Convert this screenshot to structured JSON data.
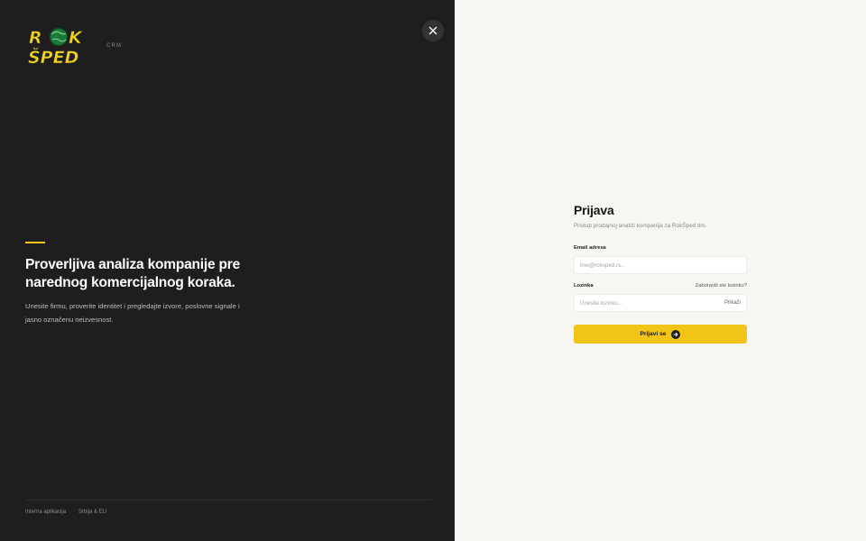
{
  "brand": {
    "logo_line1": "ROK",
    "logo_line2": "ŠPED",
    "product_tag": "CRM",
    "accent_color": "#f2c418",
    "logo_green": "#1a7a3c"
  },
  "hero": {
    "headline": "Proverljiva analiza kompanije pre narednog komercijalnog koraka.",
    "description": "Unesite firmu, proverite identitet i pregledajte izvore, poslovne signale i jasno označenu neizvesnost."
  },
  "footer": {
    "items": [
      "Interna aplikacija",
      "Srbija & EU"
    ]
  },
  "close": {
    "icon": "close-icon"
  },
  "login": {
    "title": "Prijava",
    "subtitle": "Pristup prodajnoj analizi kompanija za RokŠped tim.",
    "email_label": "Email adresa",
    "email_placeholder": "ime@roksped.rs...",
    "password_label": "Lozinka",
    "forgot_label": "Zaboravili ste lozinku?",
    "password_placeholder": "Unesite lozinku...",
    "show_label": "Prikaži",
    "submit_label": "Prijavi se",
    "submit_icon": "arrow-right-icon"
  }
}
